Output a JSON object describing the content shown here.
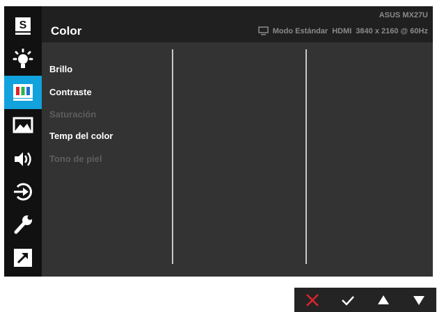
{
  "sidebar": {
    "items": [
      {
        "icon": "splendid-icon",
        "label": "S"
      },
      {
        "icon": "brightness-icon"
      },
      {
        "icon": "color-icon",
        "active": true
      },
      {
        "icon": "image-icon"
      },
      {
        "icon": "sound-icon"
      },
      {
        "icon": "input-select-icon"
      },
      {
        "icon": "system-setup-icon"
      },
      {
        "icon": "shortcut-icon"
      }
    ],
    "accent": "#12a2dd"
  },
  "header": {
    "title": "Color",
    "model": "ASUS MX27U",
    "mode": "Modo Estándar",
    "input": "HDMI",
    "resolution": "3840 x 2160 @ 60Hz"
  },
  "menu": {
    "items": [
      {
        "label": "Brillo",
        "enabled": true
      },
      {
        "label": "Contraste",
        "enabled": true
      },
      {
        "label": "Saturación",
        "enabled": false
      },
      {
        "label": "Temp del color",
        "enabled": true
      },
      {
        "label": "Tono de piel",
        "enabled": false
      }
    ]
  },
  "keys": [
    {
      "icon": "close-icon",
      "color": "#e0232d"
    },
    {
      "icon": "check-icon",
      "color": "#ffffff"
    },
    {
      "icon": "arrow-up-icon",
      "color": "#ffffff"
    },
    {
      "icon": "arrow-down-icon",
      "color": "#ffffff"
    }
  ]
}
